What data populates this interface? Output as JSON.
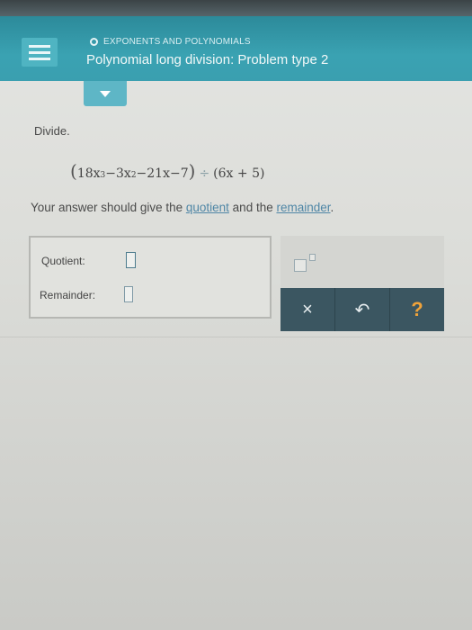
{
  "header": {
    "topic": "EXPONENTS AND POLYNOMIALS",
    "title": "Polynomial long division: Problem type 2"
  },
  "problem": {
    "instruction": "Divide.",
    "dividend_parts": [
      "18x",
      "3",
      "−3x",
      "2",
      "−21x−7"
    ],
    "divide_symbol": "÷",
    "divisor": "6x + 5",
    "open_paren": "(",
    "close_paren": ")",
    "answer_note_prefix": "Your answer should give the ",
    "quotient_link": "quotient",
    "answer_note_mid": " and the ",
    "remainder_link": "remainder",
    "answer_note_end": "."
  },
  "answer": {
    "quotient_label": "Quotient:",
    "remainder_label": "Remainder:"
  },
  "toolbar": {
    "clear_label": "×",
    "undo_label": "↶",
    "help_label": "?"
  },
  "icons": {
    "menu": "menu-icon",
    "chevron": "chevron-down-icon",
    "exponent": "exponent-template-icon"
  }
}
